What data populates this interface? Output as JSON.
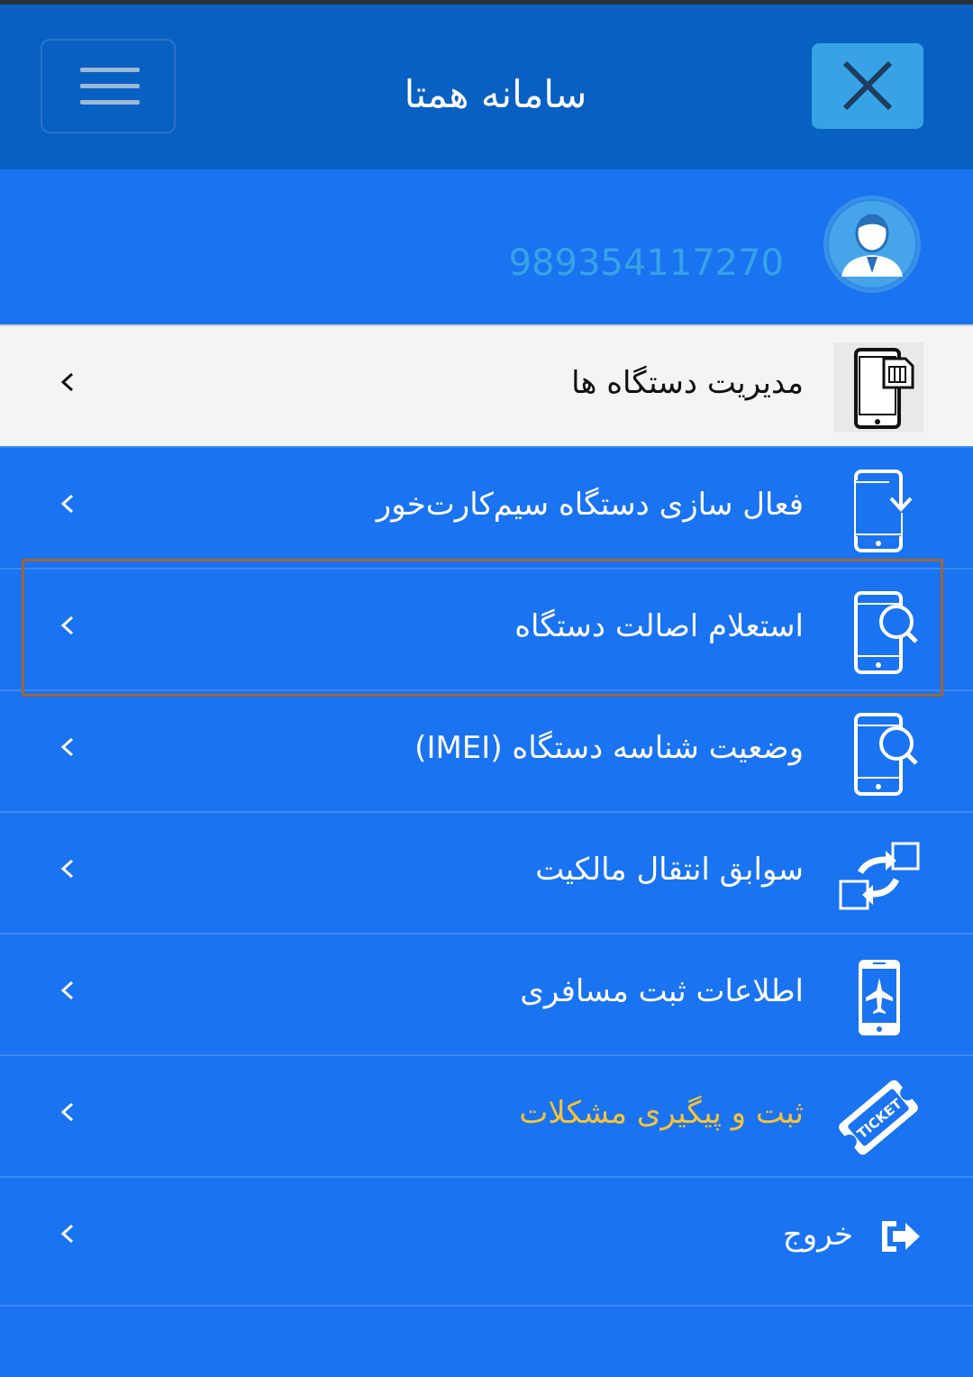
{
  "header": {
    "title": "سامانه همتا",
    "menu_icon": "hamburger-icon",
    "close_icon": "close-icon"
  },
  "profile": {
    "phone": "989354117270",
    "avatar_icon": "user-avatar-icon"
  },
  "menu": {
    "items": [
      {
        "label": "مدیریت دستگاه ها",
        "icon": "phone-sim-icon"
      },
      {
        "label": "فعال سازی دستگاه سیم‌کارت‌خور",
        "icon": "phone-download-icon"
      },
      {
        "label": "استعلام اصالت دستگاه",
        "icon": "phone-search-icon"
      },
      {
        "label": "وضعیت شناسه دستگاه (IMEI)",
        "icon": "phone-search-icon"
      },
      {
        "label": "سوابق انتقال مالکیت",
        "icon": "transfer-icon"
      },
      {
        "label": "اطلاعات ثبت مسافری",
        "icon": "phone-airplane-icon"
      },
      {
        "label": "ثبت و پیگیری مشکلات",
        "icon": "ticket-icon"
      },
      {
        "label": "خروج",
        "icon": "logout-icon"
      }
    ]
  },
  "colors": {
    "header_bg": "#0760c2",
    "body_bg": "#1a73f0",
    "accent": "#37a3e6",
    "warning_text": "#f5c23a"
  }
}
